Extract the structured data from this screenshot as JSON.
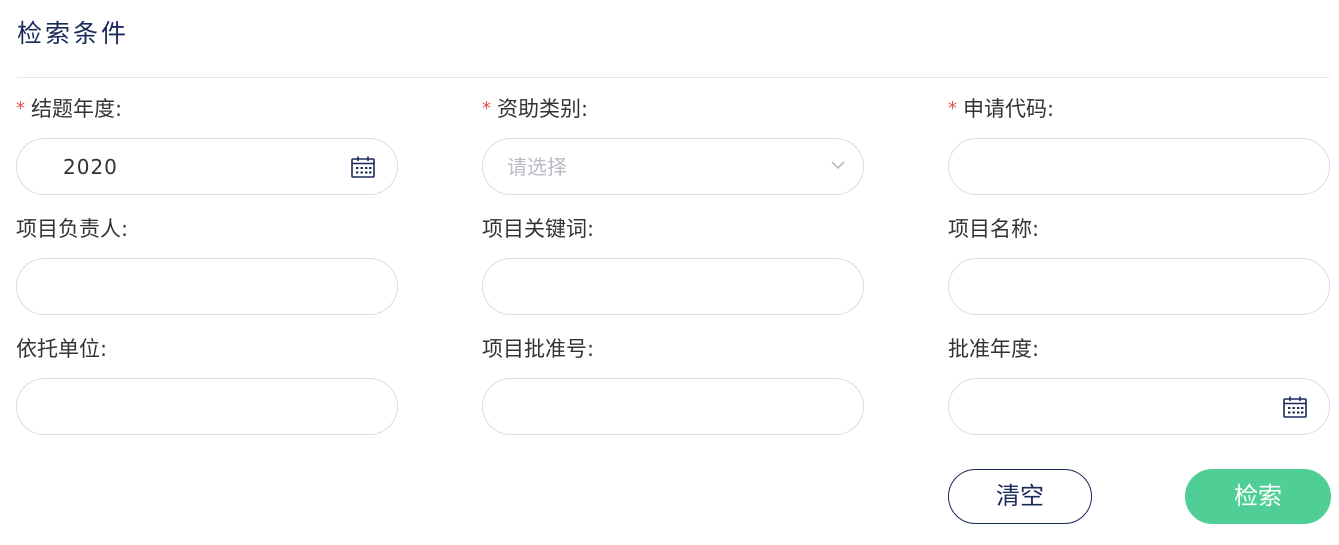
{
  "section": {
    "title": "检索条件"
  },
  "fields": {
    "conclusion_year": {
      "label": "结题年度:",
      "value": "2020",
      "required": "*"
    },
    "funding_category": {
      "label": "资助类别:",
      "placeholder": "请选择",
      "required": "*"
    },
    "application_code": {
      "label": "申请代码:",
      "value": "",
      "required": "*"
    },
    "project_leader": {
      "label": "项目负责人:",
      "value": ""
    },
    "project_keywords": {
      "label": "项目关键词:",
      "value": ""
    },
    "project_name": {
      "label": "项目名称:",
      "value": ""
    },
    "host_institution": {
      "label": "依托单位:",
      "value": ""
    },
    "project_approval_no": {
      "label": "项目批准号:",
      "value": ""
    },
    "approval_year": {
      "label": "批准年度:",
      "value": ""
    }
  },
  "buttons": {
    "clear_label": "清空",
    "search_label": "检索"
  },
  "colors": {
    "title": "#1a2a5a",
    "required": "#e05252",
    "search_button": "#4fcf95",
    "border": "#d9dde3"
  },
  "icons": {
    "calendar": "calendar-icon",
    "dropdown": "chevron-down-icon"
  }
}
